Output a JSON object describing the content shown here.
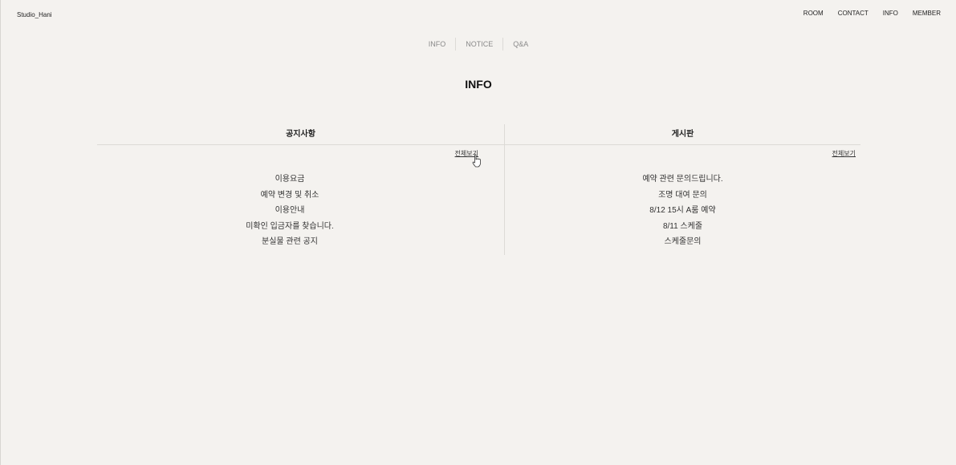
{
  "header": {
    "logo": "Studio_Hani",
    "nav": [
      "ROOM",
      "CONTACT",
      "INFO",
      "MEMBER"
    ]
  },
  "subnav": [
    "INFO",
    "NOTICE",
    "Q&A"
  ],
  "page_title": "INFO",
  "notice_board": {
    "title": "공지사항",
    "view_all": "전체보기",
    "items": [
      "이용요금",
      "예약 변경 및 취소",
      "이용안내",
      "미확인 입금자를 찾습니다.",
      "분실물 관련 공지"
    ]
  },
  "qna_board": {
    "title": "게시판",
    "view_all": "전체보기",
    "items": [
      "예약 관련 문의드립니다.",
      "조명 대여 문의",
      "8/12 15시 A룸 예약",
      "8/11 스케줄",
      "스케줄문의"
    ]
  },
  "colors": {
    "background": "#f4f2ef",
    "text": "#222222",
    "muted": "#8a8a8a",
    "divider": "#dcdad6"
  }
}
